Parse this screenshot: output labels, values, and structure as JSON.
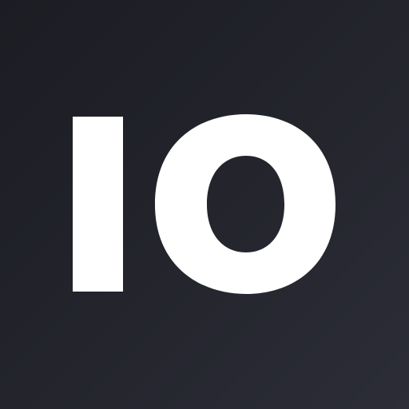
{
  "icon": {
    "logo_text": "IO",
    "background_colors": [
      "#1c1d23",
      "#2c2d37"
    ],
    "text_color": "#ffffff"
  }
}
